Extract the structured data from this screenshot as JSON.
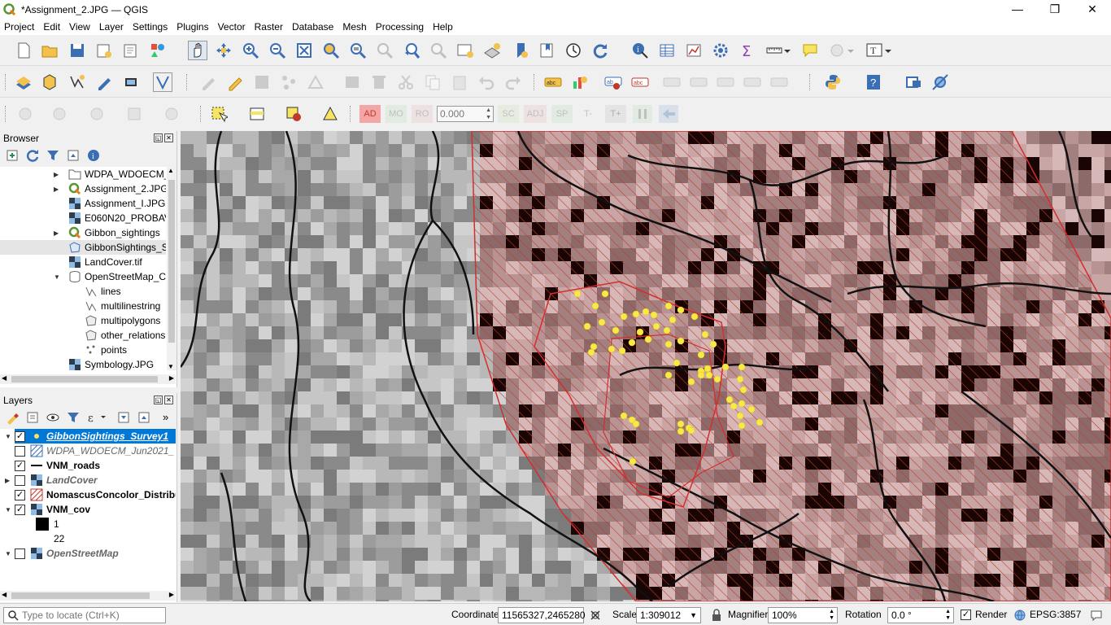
{
  "window": {
    "title": "*Assignment_2.JPG — QGIS",
    "minimize": "—",
    "maximize": "❐",
    "close": "✕"
  },
  "menu": [
    "Project",
    "Edit",
    "View",
    "Layer",
    "Settings",
    "Plugins",
    "Vector",
    "Raster",
    "Database",
    "Mesh",
    "Processing",
    "Help"
  ],
  "digitizing": {
    "ad": "AD",
    "mo": "MO",
    "ro": "RO",
    "value": "0.000",
    "sc": "SC",
    "adj": "ADJ",
    "sp": "SP",
    "t_minus": "T-",
    "t_plus": "T+"
  },
  "browser": {
    "title": "Browser",
    "items": [
      {
        "label": "WDPA_WDOECM_",
        "icon": "folder-icon"
      },
      {
        "label": "Assignment_2.JPG",
        "icon": "qgis-project-icon"
      },
      {
        "label": "Assignment_I.JPG",
        "icon": "raster-icon"
      },
      {
        "label": "E060N20_PROBAV",
        "icon": "raster-icon"
      },
      {
        "label": "Gibbon_sightings",
        "icon": "qgis-project-icon"
      },
      {
        "label": "GibbonSightings_S",
        "icon": "polygon-icon"
      },
      {
        "label": "LandCover.tif",
        "icon": "raster-icon"
      },
      {
        "label": "OpenStreetMap_C",
        "icon": "database-icon"
      },
      {
        "label": "lines",
        "icon": "line-icon"
      },
      {
        "label": "multilinestring",
        "icon": "line-icon"
      },
      {
        "label": "multipolygons",
        "icon": "polygon-icon"
      },
      {
        "label": "other_relations",
        "icon": "polygon-icon"
      },
      {
        "label": "points",
        "icon": "points-icon"
      },
      {
        "label": "Symbology.JPG",
        "icon": "raster-icon"
      }
    ]
  },
  "layers": {
    "title": "Layers",
    "items": [
      {
        "label": "GibbonSightings_Survey1"
      },
      {
        "label": "WDPA_WDOECM_Jun2021_"
      },
      {
        "label": "VNM_roads"
      },
      {
        "label": "LandCover"
      },
      {
        "label": "NomascusConcolor_Distribu"
      },
      {
        "label": "VNM_cov"
      },
      {
        "label": "1"
      },
      {
        "label": "22"
      },
      {
        "label": "OpenStreetMap"
      }
    ]
  },
  "status": {
    "locate_placeholder": "Type to locate (Ctrl+K)",
    "coordinate_label": "Coordinate",
    "coordinate_value": "11565327,2465280",
    "scale_label": "Scale",
    "scale_value": "1:309012",
    "magnifier_label": "Magnifier",
    "magnifier_value": "100%",
    "rotation_label": "Rotation",
    "rotation_value": "0.0 °",
    "render_label": "Render",
    "crs": "EPSG:3857"
  }
}
